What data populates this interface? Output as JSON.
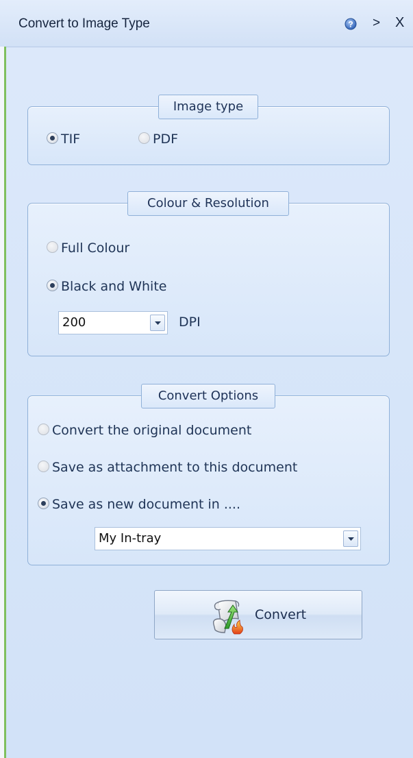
{
  "window": {
    "title": "Convert to Image Type",
    "expand_glyph": ">",
    "close_glyph": "X"
  },
  "image_type": {
    "legend": "Image type",
    "options": [
      {
        "label": "TIF",
        "selected": true,
        "enabled": true
      },
      {
        "label": "PDF",
        "selected": false,
        "enabled": false
      }
    ]
  },
  "colour_resolution": {
    "legend": "Colour & Resolution",
    "options": [
      {
        "label": "Full Colour",
        "selected": false,
        "enabled": false
      },
      {
        "label": "Black and White",
        "selected": true,
        "enabled": true
      }
    ],
    "dpi_value": "200",
    "dpi_unit": "DPI"
  },
  "convert_options": {
    "legend": "Convert Options",
    "options": [
      {
        "label": "Convert the original document",
        "selected": false,
        "enabled": false
      },
      {
        "label": "Save as attachment to this document",
        "selected": false,
        "enabled": false
      },
      {
        "label": "Save as new document in ....",
        "selected": true,
        "enabled": true
      }
    ],
    "destination": "My In-tray"
  },
  "convert_button": {
    "label": "Convert"
  },
  "icons": {
    "help": "help-icon",
    "dropdown": "chevron-down-icon",
    "convert": "scroll-convert-icon"
  },
  "colors": {
    "pane_background": "#d6e5f9",
    "group_border": "#8fb0d8",
    "text": "#203557",
    "left_accent": "#7fbf5e"
  }
}
